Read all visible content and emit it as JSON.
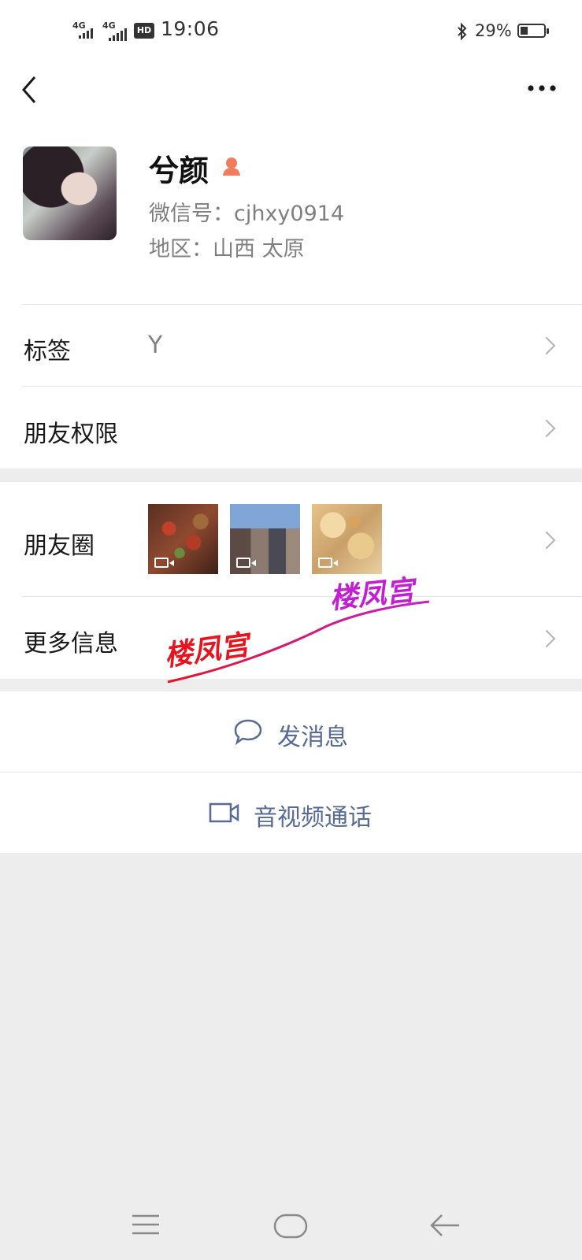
{
  "status_bar": {
    "network_1": "4G",
    "network_2": "4G",
    "hd_label": "HD",
    "time": "19:06",
    "battery": "29%",
    "icons": [
      "signal-icon",
      "hd-voice-icon",
      "bluetooth-icon",
      "battery-icon"
    ]
  },
  "header": {
    "icons": [
      "back-icon",
      "more-icon"
    ]
  },
  "profile": {
    "name": "兮颜",
    "gender_icon": "female-icon",
    "gender_color": "#f37b5d",
    "wechat_id": "微信号：cjhxy0914",
    "region": "地区：山西  太原"
  },
  "rows": {
    "tags_label": "标签",
    "tags_value": "Y",
    "permissions_label": "朋友权限",
    "moments_label": "朋友圈",
    "more_label": "更多信息"
  },
  "watermark": {
    "text_1": "楼凤宫",
    "text_2": "楼凤宫",
    "color_1": "#e8131d",
    "color_2": "#c21fd1"
  },
  "actions": {
    "message_label": "发消息",
    "call_label": "音视频通话",
    "accent": "#576b95"
  },
  "nav": {
    "icons": [
      "menu-icon",
      "home-icon",
      "back-arrow-icon"
    ]
  }
}
